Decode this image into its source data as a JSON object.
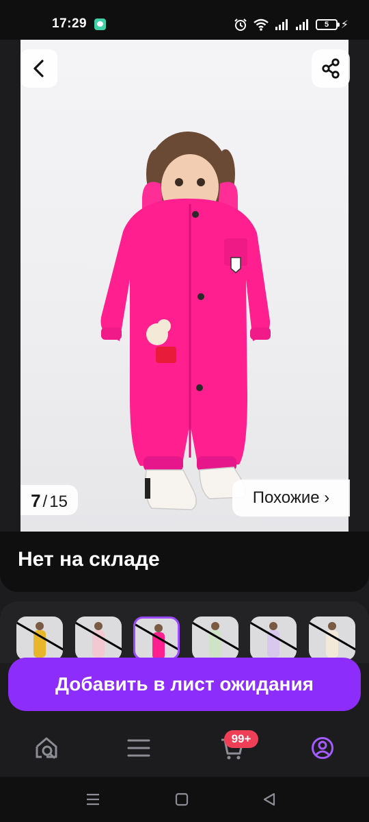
{
  "status": {
    "time": "17:29",
    "battery": "5"
  },
  "gallery": {
    "current": "7",
    "separator": "/",
    "total": "15",
    "similar_label": "Похожие ›"
  },
  "product": {
    "stock_text": "Нет на складе"
  },
  "variants": [
    {
      "color": "#e8b62a",
      "selected": false
    },
    {
      "color": "#f2c9d2",
      "selected": false
    },
    {
      "color": "#ff1f8e",
      "selected": true
    },
    {
      "color": "#cfe3c6",
      "selected": false
    },
    {
      "color": "#d9c8ee",
      "selected": false
    },
    {
      "color": "#f3e9d8",
      "selected": false
    }
  ],
  "actions": {
    "waitlist_label": "Добавить в лист ожидания"
  },
  "tabbar": {
    "cart_badge": "99+"
  },
  "colors": {
    "accent": "#8c2dfb",
    "badge": "#ee3f57",
    "product_pink": "#ff1f8e"
  }
}
